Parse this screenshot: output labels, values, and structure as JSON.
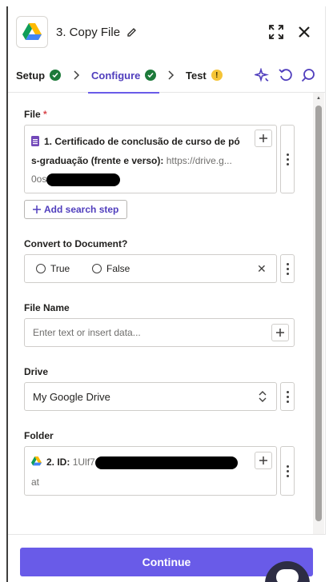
{
  "header": {
    "title": "3. Copy File",
    "app_icon": "google-drive-icon"
  },
  "tabs": [
    {
      "label": "Setup",
      "status": "complete"
    },
    {
      "label": "Configure",
      "status": "complete",
      "active": true
    },
    {
      "label": "Test",
      "status": "warning"
    }
  ],
  "tab_warning_glyph": "!",
  "fields": {
    "file": {
      "label": "File",
      "required_mark": "*",
      "line1": "1. Certificado de conclusão de curso de pó",
      "line2_bold": "s-graduação (frente e verso):",
      "line2_muted": "https://drive.g...",
      "line3_prefix": "0os"
    },
    "add_search_step": "Add search step",
    "convert": {
      "label": "Convert to Document?",
      "options": [
        "True",
        "False"
      ],
      "clear_glyph": "✕"
    },
    "file_name": {
      "label": "File Name",
      "placeholder": "Enter text or insert data..."
    },
    "drive": {
      "label": "Drive",
      "value": "My Google Drive"
    },
    "folder": {
      "label": "Folder",
      "pill_bold": "2. ID:",
      "pill_muted": "1Ulf7",
      "line2": "at"
    }
  },
  "footer": {
    "continue_label": "Continue"
  },
  "colors": {
    "accent": "#695be8",
    "accent_text": "#503ebd",
    "success": "#1d7a3a",
    "warning": "#f5c437"
  }
}
